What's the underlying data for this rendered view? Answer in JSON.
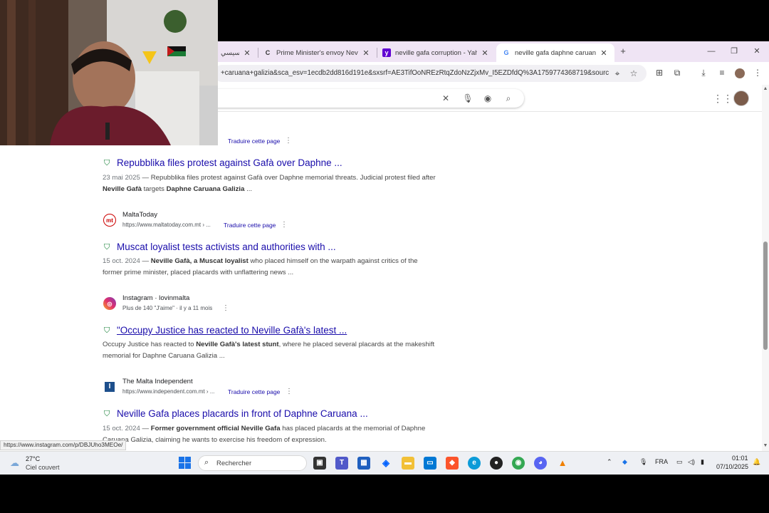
{
  "browser": {
    "tabs": [
      {
        "label": "السيسي",
        "favicon": "none"
      },
      {
        "label": "Prime Minister's envoy Neville G",
        "favicon": "C"
      },
      {
        "label": "neville gafa corruption - Yahoo",
        "favicon": "y"
      },
      {
        "label": "neville gafa daphne caruana ga",
        "favicon": "G",
        "active": true
      }
    ],
    "new_tab": "+",
    "url": "+caruana+galizia&sca_esv=1ecdb2dd816d191e&sxsrf=AE3TifOoNREzRtqZdoNzZjxMv_I5EZDfdQ%3A1759774368719&sourc..."
  },
  "results": [
    {
      "translate": "Traduire cette page",
      "title": "Repubblika files protest against Gafà over Daphne ...",
      "date": "23 mai 2025",
      "snippet_parts": [
        {
          "t": " — Repubblika files protest against Gafà over Daphne memorial threats. Judicial protest filed after ",
          "b": false
        },
        {
          "t": "Neville Gafà",
          "b": true
        },
        {
          "t": " targets ",
          "b": false
        },
        {
          "t": "Daphne Caruana Galizia",
          "b": true
        },
        {
          "t": " ...",
          "b": false
        }
      ]
    },
    {
      "source_name": "MaltaToday",
      "source_url": "https://www.maltatoday.com.mt › ...",
      "icon_text": "mt",
      "translate": "Traduire cette page",
      "title": "Muscat loyalist tests activists and authorities with ...",
      "date": "15 oct. 2024",
      "snippet_parts": [
        {
          "t": " — ",
          "b": false
        },
        {
          "t": "Neville Gafà, a Muscat loyalist",
          "b": true
        },
        {
          "t": " who placed himself on the warpath against critics of the former prime minister, placed placards with unflattering news ...",
          "b": false
        }
      ]
    },
    {
      "source_name": "Instagram · lovinmalta",
      "source_url": "Plus de 140 \"J'aime\" · il y a 11 mois",
      "title": "\"Occupy Justice has reacted to Neville Gafà's latest ...",
      "date": "",
      "snippet_parts": [
        {
          "t": "Occupy Justice has reacted to ",
          "b": false
        },
        {
          "t": "Neville Gafà's latest stunt",
          "b": true
        },
        {
          "t": ", where he placed several placards at the makeshift memorial for Daphne Caruana Galizia ...",
          "b": false
        }
      ]
    },
    {
      "source_name": "The Malta Independent",
      "source_url": "https://www.independent.com.mt › ...",
      "icon_text": "I",
      "translate": "Traduire cette page",
      "title": "Neville Gafa places placards in front of Daphne Caruana ...",
      "date": "15 oct. 2024",
      "snippet_parts": [
        {
          "t": " — ",
          "b": false
        },
        {
          "t": "Former government official Neville Gafa",
          "b": true
        },
        {
          "t": " has placed placards at the memorial of Daphne Caruana Galizia, claiming he wants to exercise his freedom of expression.",
          "b": false
        }
      ]
    }
  ],
  "status_link": "https://www.instagram.com/p/DBJUho3MEOe/",
  "taskbar": {
    "weather_temp": "27°C",
    "weather_desc": "Ciel couvert",
    "search_placeholder": "Rechercher",
    "lang": "FRA",
    "time": "01:01",
    "date": "07/10/2025"
  },
  "colors": {
    "link": "#1a0dab",
    "tab_strip": "#efe4f4",
    "verified_shield": "#188038"
  }
}
